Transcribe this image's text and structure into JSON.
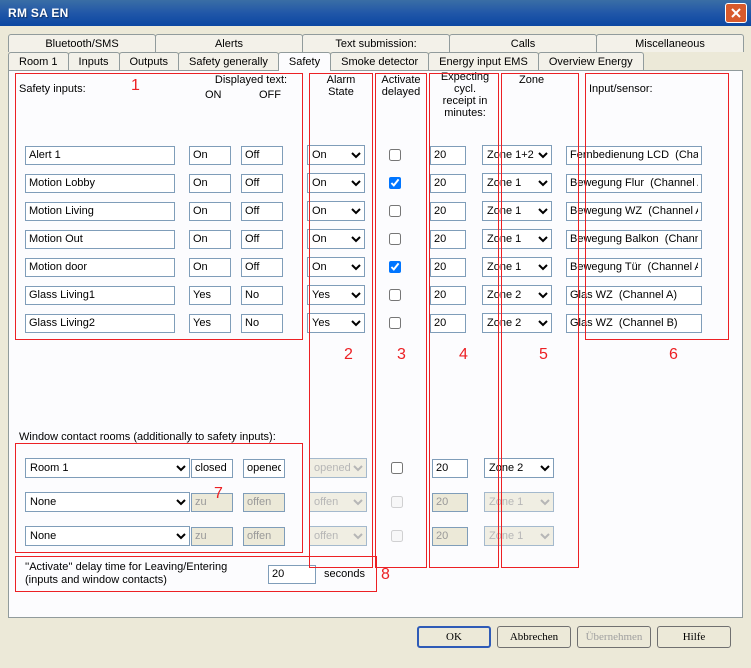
{
  "window": {
    "title": "RM SA EN"
  },
  "tabs_upper": [
    "Bluetooth/SMS",
    "Alerts",
    "Text submission:",
    "Calls",
    "Miscellaneous"
  ],
  "tabs_lower": [
    "Room 1",
    "Inputs",
    "Outputs",
    "Safety generally",
    "Safety",
    "Smoke detector",
    "Energy input EMS",
    "Overview Energy"
  ],
  "tabs": {
    "active": "Safety"
  },
  "headers": {
    "safety_inputs": "Safety inputs:",
    "displayed_text": "Displayed text:",
    "on": "ON",
    "off": "OFF",
    "alarm_state": "Alarm\nState",
    "activate_delayed": "Activate\ndelayed",
    "expecting": "Expecting cycl.\nreceipt in\nminutes:",
    "zone": "Zone",
    "input_sensor": "Input/sensor:"
  },
  "rows": [
    {
      "name": "Alert 1",
      "on": "On",
      "off": "Off",
      "alarm": "On",
      "delayed": false,
      "min": "20",
      "zone": "Zone 1+2",
      "sensor": "Fernbedienung LCD  (Channel:"
    },
    {
      "name": "Motion Lobby",
      "on": "On",
      "off": "Off",
      "alarm": "On",
      "delayed": true,
      "min": "20",
      "zone": "Zone 1",
      "sensor": "Bewegung Flur  (Channel A)"
    },
    {
      "name": "Motion Living",
      "on": "On",
      "off": "Off",
      "alarm": "On",
      "delayed": false,
      "min": "20",
      "zone": "Zone 1",
      "sensor": "Bewegung WZ  (Channel A)"
    },
    {
      "name": "Motion Out",
      "on": "On",
      "off": "Off",
      "alarm": "On",
      "delayed": false,
      "min": "20",
      "zone": "Zone 1",
      "sensor": "Bewegung Balkon  (Channel A)"
    },
    {
      "name": "Motion door",
      "on": "On",
      "off": "Off",
      "alarm": "On",
      "delayed": true,
      "min": "20",
      "zone": "Zone 1",
      "sensor": "Bewegung Tür  (Channel A)"
    },
    {
      "name": "Glass Living1",
      "on": "Yes",
      "off": "No",
      "alarm": "Yes",
      "delayed": false,
      "min": "20",
      "zone": "Zone 2",
      "sensor": "Glas WZ  (Channel A)"
    },
    {
      "name": "Glass Living2",
      "on": "Yes",
      "off": "No",
      "alarm": "Yes",
      "delayed": false,
      "min": "20",
      "zone": "Zone 2",
      "sensor": "Glas WZ  (Channel B)"
    }
  ],
  "window_contact": {
    "label": "Window contact rooms (additionally to safety inputs):",
    "rows": [
      {
        "room": "Room 1",
        "closed": "closed",
        "opened": "opened",
        "alarm": "opened",
        "alarm_disabled": true,
        "delayed": false,
        "delayed_disabled": false,
        "min": "20",
        "min_disabled": false,
        "zone": "Zone 2",
        "zone_disabled": false
      },
      {
        "room": "None",
        "closed": "zu",
        "opened": "offen",
        "alarm": "offen",
        "alarm_disabled": true,
        "delayed": false,
        "delayed_disabled": true,
        "min": "20",
        "min_disabled": true,
        "zone": "Zone 1",
        "zone_disabled": true,
        "room_none": true
      },
      {
        "room": "None",
        "closed": "zu",
        "opened": "offen",
        "alarm": "offen",
        "alarm_disabled": true,
        "delayed": false,
        "delayed_disabled": true,
        "min": "20",
        "min_disabled": true,
        "zone": "Zone 1",
        "zone_disabled": true,
        "room_none": true
      }
    ]
  },
  "delay": {
    "label": "''Activate'' delay time for Leaving/Entering (inputs and window contacts)",
    "value": "20",
    "unit": "seconds"
  },
  "annotations": [
    "1",
    "2",
    "3",
    "4",
    "5",
    "6",
    "7",
    "8"
  ],
  "buttons": {
    "ok": "OK",
    "cancel": "Abbrechen",
    "apply": "Übernehmen",
    "help": "Hilfe"
  }
}
